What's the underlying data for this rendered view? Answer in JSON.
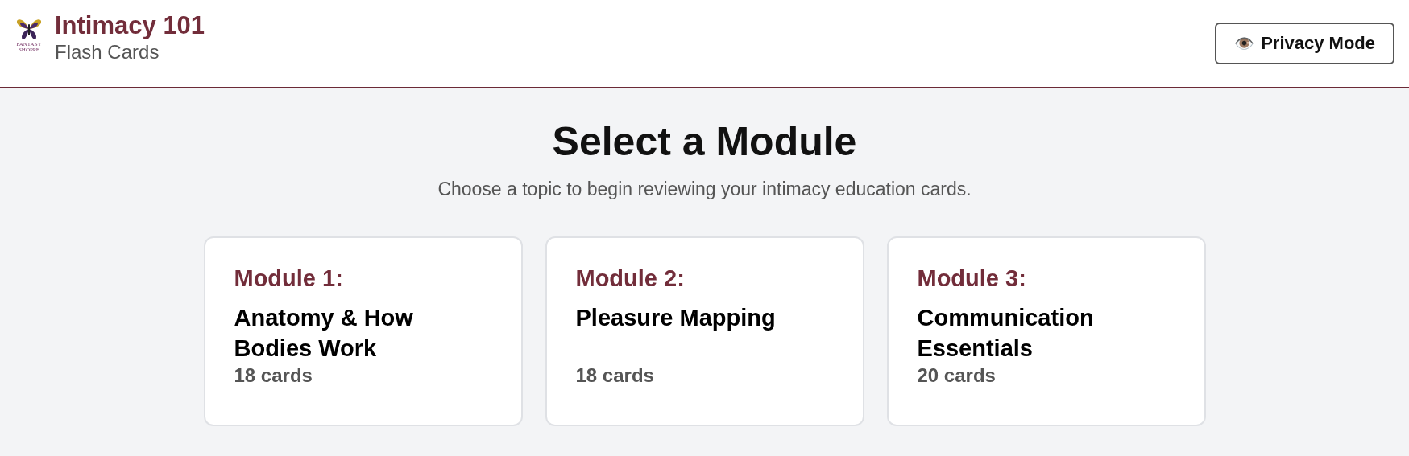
{
  "header": {
    "logo_text": [
      "FANTASY",
      "SHOPPE"
    ],
    "title": "Intimacy 101",
    "subtitle": "Flash Cards",
    "privacy_button": {
      "icon": "👁️",
      "label": "Privacy Mode"
    }
  },
  "main": {
    "heading": "Select a Module",
    "description": "Choose a topic to begin reviewing your intimacy education cards.",
    "modules": [
      {
        "label": "Module 1:",
        "title": "Anatomy & How Bodies Work",
        "count": "18 cards"
      },
      {
        "label": "Module 2:",
        "title": "Pleasure Mapping",
        "count": "18 cards"
      },
      {
        "label": "Module 3:",
        "title": "Communication Essentials",
        "count": "20 cards"
      }
    ]
  }
}
